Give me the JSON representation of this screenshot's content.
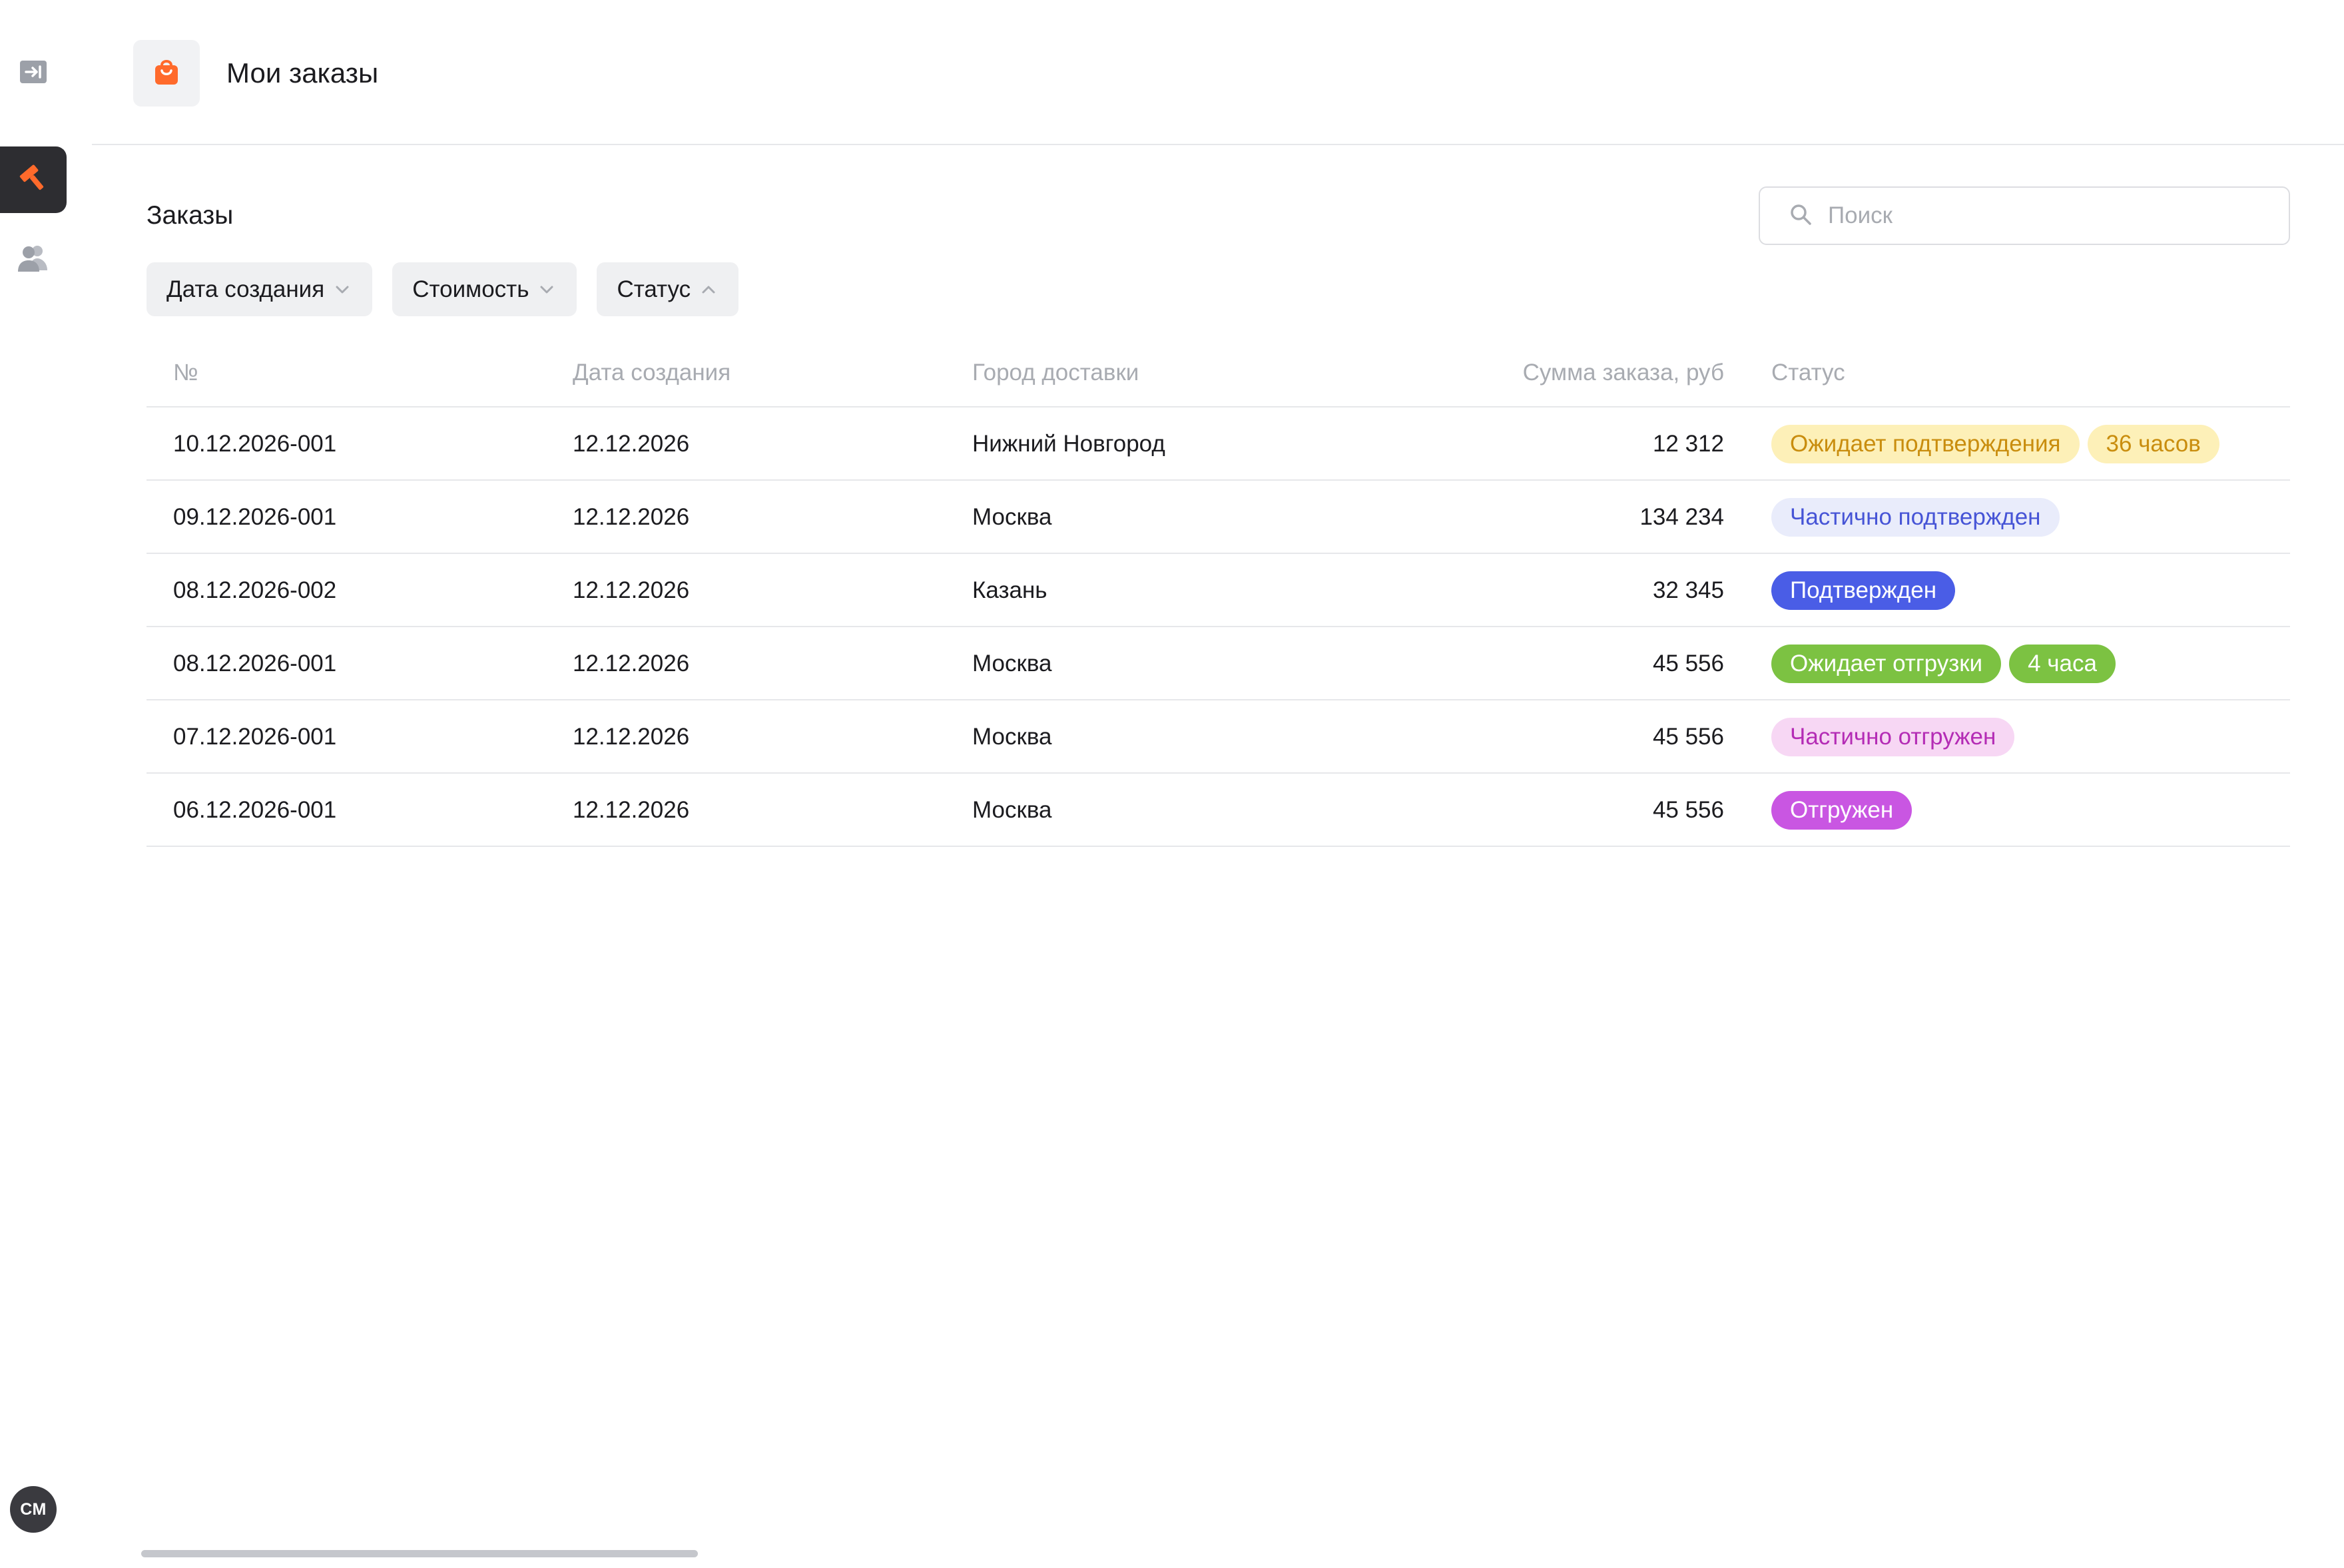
{
  "header": {
    "title": "Мои заказы",
    "logo_icon": "shopping-bag-icon",
    "logo_color": "#ff6a2b"
  },
  "sidebar": {
    "items": [
      {
        "icon": "sidebar-expand-icon",
        "active": false
      },
      {
        "icon": "hammer-icon",
        "active": true,
        "accent": "#ff6a2b"
      },
      {
        "icon": "users-icon",
        "active": false
      }
    ],
    "avatar_initials": "СМ"
  },
  "orders": {
    "title": "Заказы",
    "search": {
      "placeholder": "Поиск",
      "value": "",
      "icon": "search-icon"
    },
    "filters": [
      {
        "label": "Дата создания",
        "icon": "chevron-down-icon"
      },
      {
        "label": "Стоимость",
        "icon": "chevron-down-icon"
      },
      {
        "label": "Статус",
        "icon": "chevron-up-icon"
      }
    ],
    "columns": [
      "№",
      "Дата создания",
      "Город доставки",
      "Сумма заказа, руб",
      "Статус"
    ],
    "rows": [
      {
        "no": "10.12.2026-001",
        "date": "12.12.2026",
        "city": "Нижний Новгород",
        "sum": "12 312",
        "badges": [
          {
            "text": "Ожидает подтверждения",
            "bg": "#fdf0b8",
            "fg": "#c98d0e"
          },
          {
            "text": "36 часов",
            "bg": "#fdf0b8",
            "fg": "#c98d0e"
          }
        ]
      },
      {
        "no": "09.12.2026-001",
        "date": "12.12.2026",
        "city": "Москва",
        "sum": "134 234",
        "badges": [
          {
            "text": "Частично подтвержден",
            "bg": "#e9ecfb",
            "fg": "#4654d6"
          }
        ]
      },
      {
        "no": "08.12.2026-002",
        "date": "12.12.2026",
        "city": "Казань",
        "sum": "32 345",
        "badges": [
          {
            "text": "Подтвержден",
            "bg": "#4a5de6",
            "fg": "#ffffff"
          }
        ]
      },
      {
        "no": "08.12.2026-001",
        "date": "12.12.2026",
        "city": "Москва",
        "sum": "45 556",
        "badges": [
          {
            "text": "Ожидает отгрузки",
            "bg": "#7cc242",
            "fg": "#ffffff"
          },
          {
            "text": "4 часа",
            "bg": "#7cc242",
            "fg": "#ffffff"
          }
        ]
      },
      {
        "no": "07.12.2026-001",
        "date": "12.12.2026",
        "city": "Москва",
        "sum": "45 556",
        "badges": [
          {
            "text": "Частично отгружен",
            "bg": "#f7d7f4",
            "fg": "#b42cb5"
          }
        ]
      },
      {
        "no": "06.12.2026-001",
        "date": "12.12.2026",
        "city": "Москва",
        "sum": "45 556",
        "badges": [
          {
            "text": "Отгружен",
            "bg": "#c956e2",
            "fg": "#ffffff"
          }
        ]
      }
    ]
  }
}
